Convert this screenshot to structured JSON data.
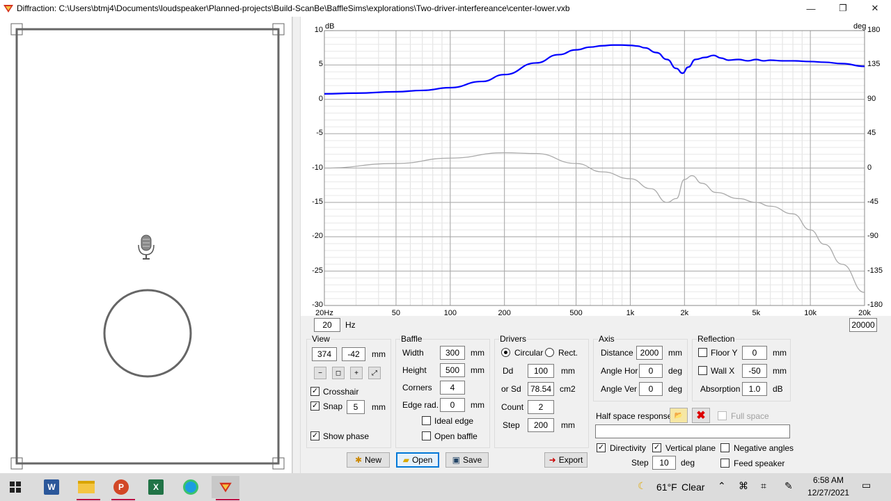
{
  "window": {
    "title": "Diffraction: C:\\Users\\btmj4\\Documents\\loudspeaker\\Planned-projects\\Build-ScanBe\\BaffleSims\\explorations\\Two-driver-interfereance\\center-lower.vxb",
    "minimize": "—",
    "maximize": "❐",
    "close": "✕"
  },
  "plot": {
    "left_unit": "dB",
    "right_unit": "deg",
    "y_ticks": [
      "10",
      "5",
      "0",
      "-5",
      "-10",
      "-15",
      "-20",
      "-25",
      "-30"
    ],
    "y2_ticks": [
      "180",
      "135",
      "90",
      "45",
      "0",
      "-45",
      "-90",
      "-135",
      "-180"
    ],
    "x_ticks": [
      "20Hz",
      "50",
      "100",
      "200",
      "500",
      "1k",
      "2k",
      "5k",
      "10k",
      "20k"
    ],
    "freq_min": "20",
    "freq_unit": "Hz",
    "freq_max": "20000"
  },
  "chart_data": {
    "type": "line",
    "x_scale": "log",
    "xlim": [
      20,
      20000
    ],
    "ylim": [
      -30,
      10
    ],
    "y2lim": [
      -180,
      180
    ],
    "series": [
      {
        "axis": "left",
        "color": "#0000ff",
        "x": [
          20,
          30,
          50,
          70,
          100,
          150,
          200,
          300,
          400,
          500,
          600,
          700,
          800,
          900,
          1000,
          1100,
          1200,
          1400,
          1600,
          1800,
          1950,
          2100,
          2300,
          2600,
          2900,
          3200,
          3500,
          4000,
          4500,
          5000,
          5500,
          6000,
          7000,
          8000,
          10000,
          12000,
          15000,
          20000
        ],
        "y": [
          0.8,
          0.9,
          1.1,
          1.3,
          1.7,
          2.6,
          3.6,
          5.3,
          6.5,
          7.2,
          7.6,
          7.8,
          7.9,
          7.9,
          7.85,
          7.75,
          7.5,
          6.8,
          5.8,
          4.5,
          3.8,
          4.7,
          5.8,
          6.1,
          6.4,
          6.0,
          5.7,
          5.8,
          5.6,
          5.8,
          5.6,
          5.7,
          5.6,
          5.6,
          5.5,
          5.4,
          5.2,
          4.8
        ]
      },
      {
        "axis": "right",
        "color": "#aaaaaa",
        "x": [
          20,
          50,
          100,
          200,
          300,
          500,
          700,
          1000,
          1300,
          1600,
          1800,
          2000,
          2200,
          2500,
          3000,
          4000,
          5000,
          6000,
          8000,
          10000,
          12000,
          15000,
          20000
        ],
        "y": [
          0,
          6,
          13,
          20,
          19,
          6,
          -5,
          -14,
          -27,
          -45,
          -40,
          -15,
          -10,
          -20,
          -32,
          -40,
          -45,
          -50,
          -60,
          -81,
          -100,
          -126,
          -163
        ]
      }
    ]
  },
  "view": {
    "title": "View",
    "x": "374",
    "y": "-42",
    "unit": "mm",
    "crosshair": "Crosshair",
    "snap": "Snap",
    "snap_val": "5",
    "snap_unit": "mm",
    "show_phase": "Show phase"
  },
  "baffle": {
    "title": "Baffle",
    "width_lbl": "Width",
    "width": "300",
    "width_unit": "mm",
    "height_lbl": "Height",
    "height": "500",
    "height_unit": "mm",
    "corners_lbl": "Corners",
    "corners": "4",
    "edge_lbl": "Edge rad.",
    "edge": "0",
    "edge_unit": "mm",
    "ideal_edge": "Ideal edge",
    "open_baffle": "Open baffle"
  },
  "drivers": {
    "title": "Drivers",
    "circular": "Circular",
    "rect": "Rect.",
    "dd_lbl": "Dd",
    "dd": "100",
    "dd_unit": "mm",
    "sd_lbl": "or Sd",
    "sd": "78.54",
    "sd_unit": "cm2",
    "count_lbl": "Count",
    "count": "2",
    "step_lbl": "Step",
    "step": "200",
    "step_unit": "mm"
  },
  "axis": {
    "title": "Axis",
    "distance_lbl": "Distance",
    "distance": "2000",
    "distance_unit": "mm",
    "hor_lbl": "Angle Hor",
    "hor": "0",
    "hor_unit": "deg",
    "ver_lbl": "Angle Ver",
    "ver": "0",
    "ver_unit": "deg"
  },
  "reflection": {
    "title": "Reflection",
    "floor": "Floor Y",
    "floor_val": "0",
    "floor_unit": "mm",
    "wall": "Wall  X",
    "wall_val": "-50",
    "wall_unit": "mm",
    "absorption_lbl": "Absorption",
    "absorption": "1.0",
    "absorption_unit": "dB"
  },
  "halfspace": {
    "label": "Half space response",
    "full_space": "Full space",
    "directivity": "Directivity",
    "vertical_plane": "Vertical plane",
    "negative_angles": "Negative angles",
    "step_lbl": "Step",
    "step": "10",
    "step_unit": "deg",
    "feed_speaker": "Feed speaker"
  },
  "buttons": {
    "new": "New",
    "open": "Open",
    "save": "Save",
    "export": "Export"
  },
  "taskbar": {
    "weather_temp": "61°F",
    "weather_cond": "Clear",
    "time": "6:58 AM",
    "date": "12/27/2021"
  }
}
